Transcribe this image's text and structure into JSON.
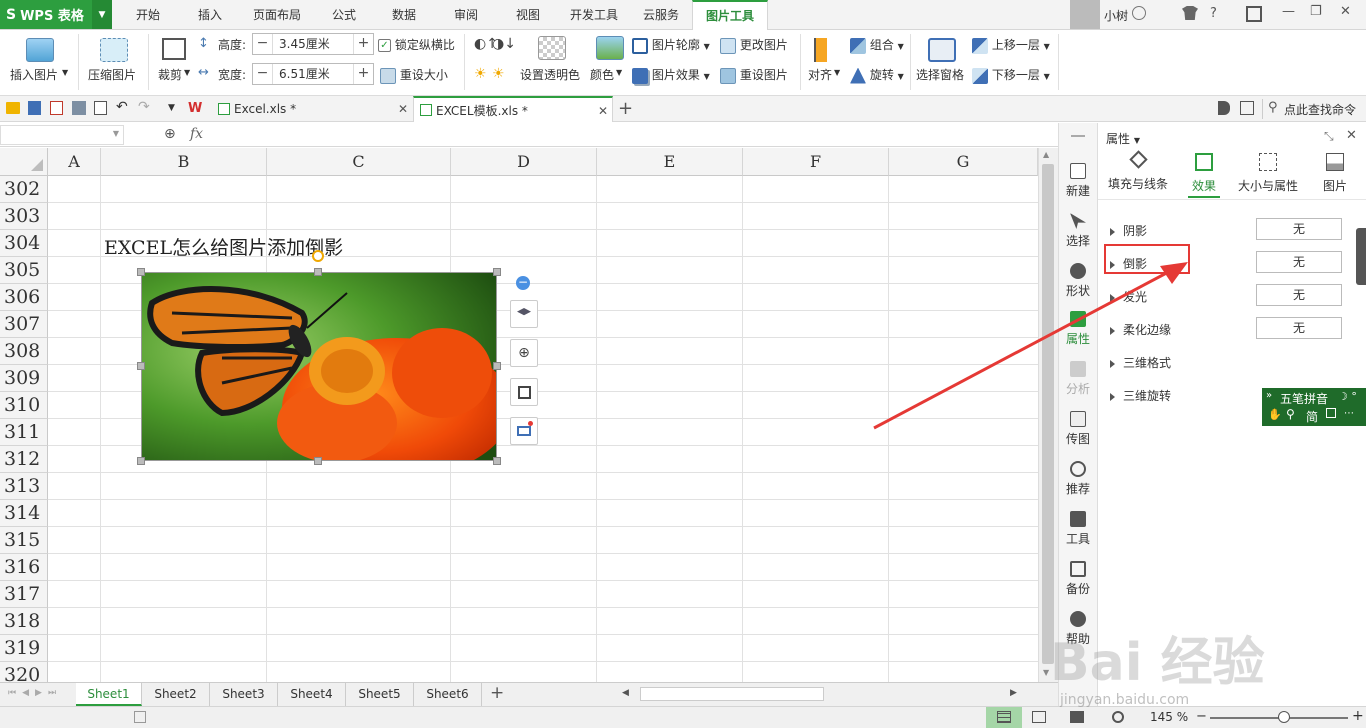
{
  "app": {
    "logo": "WPS 表格"
  },
  "menu": {
    "items": [
      "开始",
      "插入",
      "页面布局",
      "公式",
      "数据",
      "审阅",
      "视图",
      "开发工具",
      "云服务",
      "图片工具"
    ],
    "active": "图片工具",
    "user": "小树",
    "help": "?"
  },
  "ribbon": {
    "insert_pic": "插入图片",
    "compress": "压缩图片",
    "crop": "裁剪",
    "height_label": "高度:",
    "height_value": "3.45厘米",
    "width_label": "宽度:",
    "width_value": "6.51厘米",
    "lock_ratio": "锁定纵横比",
    "reset_size": "重设大小",
    "set_transparent": "设置透明色",
    "color": "颜色",
    "pic_outline": "图片轮廓",
    "pic_effect": "图片效果",
    "change_pic": "更改图片",
    "reset_pic": "重设图片",
    "align": "对齐",
    "group": "组合",
    "rotate": "旋转",
    "select_pane": "选择窗格",
    "bring_forward": "上移一层",
    "send_backward": "下移一层"
  },
  "docbar": {
    "tabs": [
      "Excel.xls *",
      "EXCEL模板.xls *"
    ],
    "search": "点此查找命令"
  },
  "formula": {
    "fx": "fx"
  },
  "grid": {
    "columns": [
      "A",
      "B",
      "C",
      "D",
      "E",
      "F",
      "G"
    ],
    "rows": [
      "302",
      "303",
      "304",
      "305",
      "306",
      "307",
      "308",
      "309",
      "310",
      "311",
      "312",
      "313",
      "314",
      "315",
      "316",
      "317",
      "318",
      "319",
      "320"
    ],
    "cell_text": "EXCEL怎么给图片添加倒影"
  },
  "sheets": {
    "tabs": [
      "Sheet1",
      "Sheet2",
      "Sheet3",
      "Sheet4",
      "Sheet5",
      "Sheet6"
    ],
    "active": "Sheet1"
  },
  "status": {
    "zoom": "145 %"
  },
  "sidebar": {
    "items": [
      "新建",
      "选择",
      "形状",
      "属性",
      "分析",
      "传图",
      "推荐",
      "工具",
      "备份",
      "帮助"
    ]
  },
  "panel": {
    "title": "属性",
    "tabs": [
      "填充与线条",
      "效果",
      "大小与属性",
      "图片"
    ],
    "active_tab": "效果",
    "rows": [
      {
        "label": "阴影",
        "value": "无"
      },
      {
        "label": "倒影",
        "value": "无"
      },
      {
        "label": "发光",
        "value": "无"
      },
      {
        "label": "柔化边缘",
        "value": "无"
      },
      {
        "label": "三维格式",
        "value": ""
      },
      {
        "label": "三维旋转",
        "value": ""
      }
    ]
  },
  "ime": {
    "name": "五笔拼音",
    "mode": "简"
  },
  "watermark": {
    "main": "Bai 经验",
    "sub": "jingyan.baidu.com"
  },
  "colors": {
    "accent": "#2d9e3f",
    "highlight": "#e53935"
  }
}
